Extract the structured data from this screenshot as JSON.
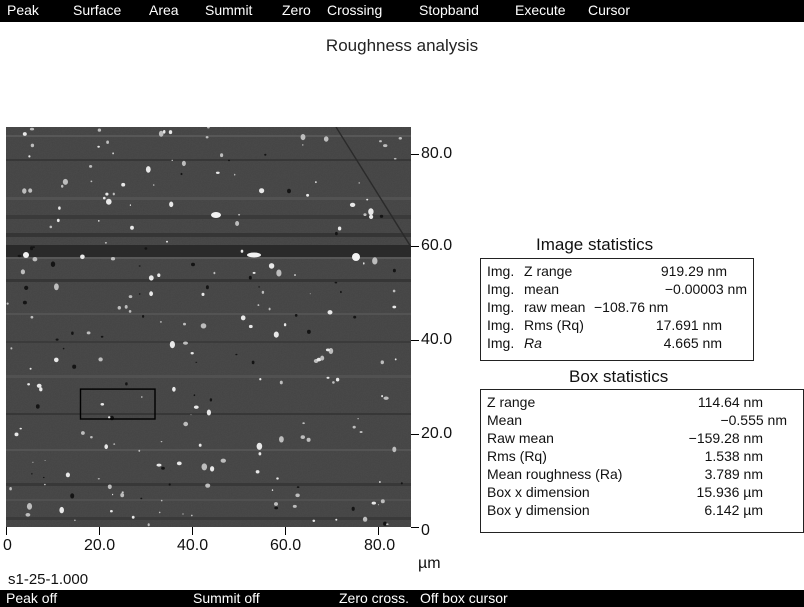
{
  "menu": {
    "items": [
      "Peak",
      "Surface",
      "Area",
      "Summit",
      "Zero",
      "Crossing",
      "Stopband",
      "Execute",
      "Cursor"
    ]
  },
  "title": "Roughness analysis",
  "plot": {
    "y_axis_ticks": [
      "80.0",
      "60.0",
      "40.0",
      "20.0",
      "0"
    ],
    "x_axis_ticks": [
      "0",
      "20.0",
      "40.0",
      "60.0",
      "80.0"
    ],
    "x_unit": "µm",
    "scan_size_um": 87,
    "selection_box": {
      "x_um": [
        16,
        32
      ],
      "y_um": [
        23.5,
        30
      ]
    }
  },
  "image_statistics": {
    "title": "Image statistics",
    "rows": [
      {
        "prefix": "Img.",
        "label": "Z range",
        "value": "919.29 nm"
      },
      {
        "prefix": "Img.",
        "label": "mean",
        "value": "−0.00003 nm"
      },
      {
        "prefix": "Img.",
        "label": "raw mean",
        "value": "−108.76 nm"
      },
      {
        "prefix": "Img.",
        "label": "Rms (Rq)",
        "value": "17.691 nm"
      },
      {
        "prefix": "Img.",
        "label": "Ra",
        "value": "4.665 nm"
      }
    ]
  },
  "box_statistics": {
    "title": "Box statistics",
    "rows": [
      {
        "label": "Z range",
        "value": "114.64 nm"
      },
      {
        "label": "Mean",
        "value": "−0.555 nm"
      },
      {
        "label": "Raw mean",
        "value": "−159.28 nm"
      },
      {
        "label": "Rms (Rq)",
        "value": "1.538 nm"
      },
      {
        "label": "Mean roughness (Ra)",
        "value": "3.789 nm"
      },
      {
        "label": "Box x dimension",
        "value": "15.936 µm"
      },
      {
        "label": "Box y dimension",
        "value": "6.142 µm"
      }
    ]
  },
  "sample_id": "s1-25-1.000",
  "status": {
    "items": [
      "Peak off",
      "Summit off",
      "Zero cross.",
      "Off box cursor"
    ]
  }
}
